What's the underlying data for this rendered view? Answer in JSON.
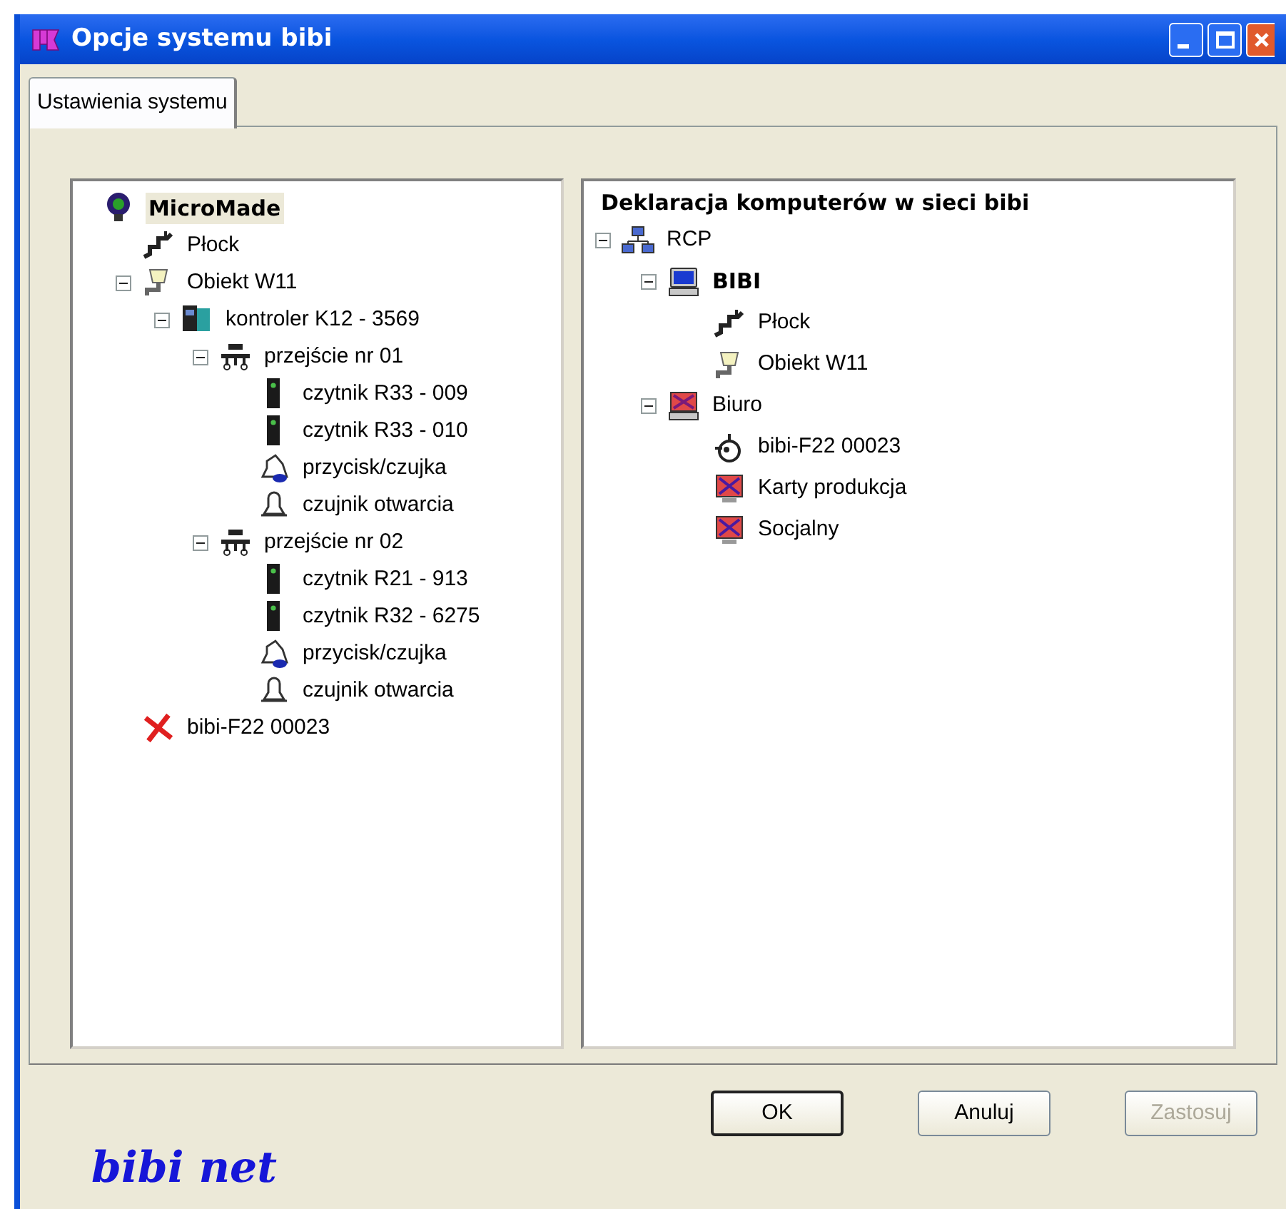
{
  "window": {
    "title": "Opcje systemu bibi"
  },
  "tabs": [
    {
      "label": "Ustawienia systemu",
      "selected": true
    }
  ],
  "left_tree": [
    {
      "label": "MicroMade",
      "kind": "bulb",
      "bold": true,
      "selected": true,
      "children": [
        {
          "label": "Płock",
          "kind": "pipe",
          "bold": false,
          "selected": false
        },
        {
          "label": "Obiekt W11",
          "kind": "plug",
          "bold": false,
          "selected": false,
          "expanded": true,
          "children": [
            {
              "label": "kontroler K12 - 3569",
              "kind": "controller",
              "bold": false,
              "selected": false,
              "expanded": true,
              "children": [
                {
                  "label": "przejście nr 01",
                  "kind": "gate",
                  "bold": false,
                  "selected": false,
                  "expanded": true,
                  "children": [
                    {
                      "label": "czytnik R33 - 009",
                      "kind": "reader",
                      "bold": false,
                      "selected": false
                    },
                    {
                      "label": "czytnik R33 - 010",
                      "kind": "reader",
                      "bold": false,
                      "selected": false
                    },
                    {
                      "label": "przycisk/czujka",
                      "kind": "bellbutton",
                      "bold": false,
                      "selected": false
                    },
                    {
                      "label": "czujnik otwarcia",
                      "kind": "bell",
                      "bold": false,
                      "selected": false
                    }
                  ]
                },
                {
                  "label": "przejście nr 02",
                  "kind": "gate",
                  "bold": false,
                  "selected": false,
                  "expanded": true,
                  "children": [
                    {
                      "label": "czytnik R21 - 913",
                      "kind": "reader",
                      "bold": false,
                      "selected": false
                    },
                    {
                      "label": "czytnik R32 - 6275",
                      "kind": "reader",
                      "bold": false,
                      "selected": false
                    },
                    {
                      "label": "przycisk/czujka",
                      "kind": "bellbutton",
                      "bold": false,
                      "selected": false
                    },
                    {
                      "label": "czujnik otwarcia",
                      "kind": "bell",
                      "bold": false,
                      "selected": false
                    }
                  ]
                }
              ]
            }
          ]
        },
        {
          "label": "bibi-F22 00023",
          "kind": "cross",
          "bold": false,
          "selected": false
        }
      ]
    }
  ],
  "right_panel": {
    "heading": "Deklaracja komputerów w sieci bibi",
    "tree": [
      {
        "label": "RCP",
        "kind": "network",
        "bold": false,
        "selected": false,
        "expanded": true,
        "children": [
          {
            "label": "BIBI",
            "kind": "computer",
            "bold": true,
            "selected": false,
            "expanded": true,
            "children": [
              {
                "label": "Płock",
                "kind": "pipe",
                "bold": false,
                "selected": false
              },
              {
                "label": "Obiekt W11",
                "kind": "plug",
                "bold": false,
                "selected": false
              }
            ]
          },
          {
            "label": "Biuro",
            "kind": "crossedcomputer",
            "bold": false,
            "selected": false,
            "expanded": true,
            "children": [
              {
                "label": "bibi-F22 00023",
                "kind": "device",
                "bold": false,
                "selected": false
              },
              {
                "label": "Karty produkcja",
                "kind": "crossedmonitor",
                "bold": false,
                "selected": false
              },
              {
                "label": "Socjalny",
                "kind": "crossedmonitor",
                "bold": false,
                "selected": false
              }
            ]
          }
        ]
      }
    ]
  },
  "buttons": [
    {
      "label": "OK",
      "default": true,
      "disabled": false
    },
    {
      "label": "Anuluj",
      "default": false,
      "disabled": false
    },
    {
      "label": "Zastosuj",
      "default": false,
      "disabled": true
    }
  ],
  "logo": "bibi net"
}
